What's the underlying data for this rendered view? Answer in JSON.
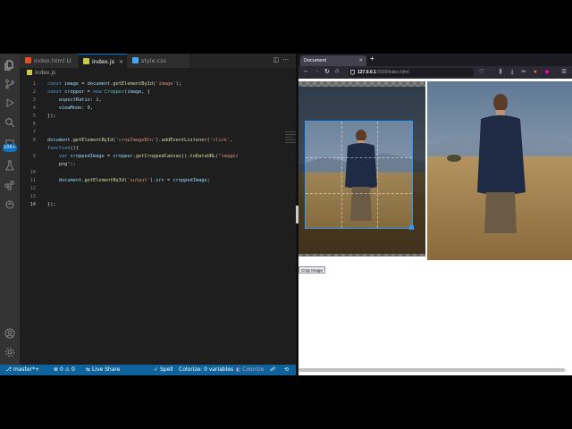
{
  "vscode": {
    "tabs": [
      {
        "label": "index.html",
        "status": "U"
      },
      {
        "label": "index.js"
      },
      {
        "label": "style.css"
      }
    ],
    "breadcrumb": "index.js",
    "line_numbers": [
      "1",
      "2",
      "3",
      "4",
      "5",
      "6",
      "7",
      "8",
      "",
      "9",
      "",
      "10",
      "11",
      "12",
      "13",
      "14"
    ],
    "current_line": "14",
    "code_lines": [
      "const image = document.getElementById('image');",
      "const cropper = new Cropper(image, {",
      "    aspectRatio: 1,",
      "    viewMode: 0,",
      "});",
      "",
      "",
      "document.getElementById('cropImageBtn').addEventListener('click',",
      "function(){",
      "    var croppedImage = cropper.getCroppedCanvas().toDataURL(\"image/",
      "    png\");",
      "",
      "    document.getElementById('output').src = croppedImage;",
      "",
      "",
      "});"
    ],
    "badge": "10K+",
    "status": {
      "branch": "master*+",
      "errors": "0",
      "warnings": "0",
      "live_share": "Live Share",
      "spell": "Spell",
      "colorize_vars": "Colorize: 0 variables",
      "colorize": "Colorize"
    }
  },
  "browser": {
    "tab_title": "Document",
    "url_host": "127.0.0.1",
    "url_path": ":5500/index.html",
    "crop_button": "Crop Image"
  },
  "colors": {
    "status_bar": "#0e639c",
    "crop_accent": "#3399ff",
    "sky": "#7d94b0",
    "field": "#b39360",
    "jacket": "#1f2a44"
  }
}
